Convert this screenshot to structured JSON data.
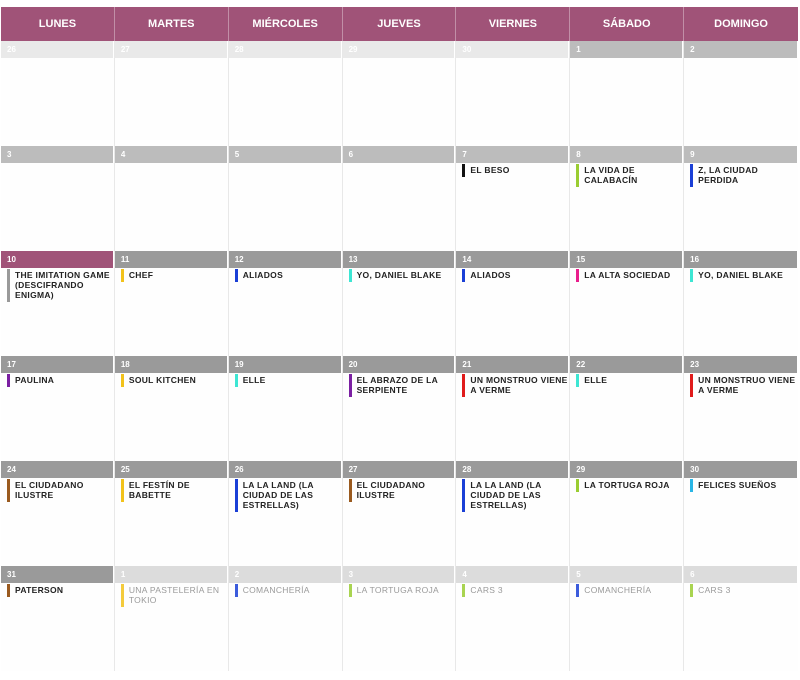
{
  "header": {
    "days": [
      "LUNES",
      "MARTES",
      "MIÉRCOLES",
      "JUEVES",
      "VIERNES",
      "SÁBADO",
      "DOMINGO"
    ]
  },
  "weeks": [
    [
      {
        "day": "26",
        "state": "outside",
        "events": []
      },
      {
        "day": "27",
        "state": "outside",
        "events": []
      },
      {
        "day": "28",
        "state": "outside",
        "events": []
      },
      {
        "day": "29",
        "state": "outside",
        "events": []
      },
      {
        "day": "30",
        "state": "outside",
        "events": []
      },
      {
        "day": "1",
        "state": "current",
        "events": []
      },
      {
        "day": "2",
        "state": "current",
        "events": []
      }
    ],
    [
      {
        "day": "3",
        "state": "current",
        "events": []
      },
      {
        "day": "4",
        "state": "current",
        "events": []
      },
      {
        "day": "5",
        "state": "current",
        "events": []
      },
      {
        "day": "6",
        "state": "current",
        "events": []
      },
      {
        "day": "7",
        "state": "current",
        "events": [
          {
            "title": "EL BESO",
            "color": "#111111"
          }
        ]
      },
      {
        "day": "8",
        "state": "current",
        "events": [
          {
            "title": "LA VIDA DE CALABACÍN",
            "color": "#9acd32"
          }
        ]
      },
      {
        "day": "9",
        "state": "current",
        "events": [
          {
            "title": "Z, LA CIUDAD PERDIDA",
            "color": "#1a3fd6"
          }
        ]
      }
    ],
    [
      {
        "day": "10",
        "state": "today",
        "events": [
          {
            "title": "THE IMITATION GAME (DESCIFRANDO ENIGMA)",
            "color": "#999999"
          }
        ]
      },
      {
        "day": "11",
        "state": "dark",
        "events": [
          {
            "title": "CHEF",
            "color": "#f2c21a"
          }
        ]
      },
      {
        "day": "12",
        "state": "dark",
        "events": [
          {
            "title": "ALIADOS",
            "color": "#1a3fd6"
          }
        ]
      },
      {
        "day": "13",
        "state": "dark",
        "events": [
          {
            "title": "YO, DANIEL BLAKE",
            "color": "#3de6d3"
          }
        ]
      },
      {
        "day": "14",
        "state": "dark",
        "events": [
          {
            "title": "ALIADOS",
            "color": "#1a3fd6"
          }
        ]
      },
      {
        "day": "15",
        "state": "dark",
        "events": [
          {
            "title": "LA ALTA SOCIEDAD",
            "color": "#e91e8c"
          }
        ]
      },
      {
        "day": "16",
        "state": "dark",
        "events": [
          {
            "title": "YO, DANIEL BLAKE",
            "color": "#3de6d3"
          }
        ]
      }
    ],
    [
      {
        "day": "17",
        "state": "dark",
        "events": [
          {
            "title": "PAULINA",
            "color": "#7b1fa2"
          }
        ]
      },
      {
        "day": "18",
        "state": "dark",
        "events": [
          {
            "title": "SOUL KITCHEN",
            "color": "#f2c21a"
          }
        ]
      },
      {
        "day": "19",
        "state": "dark",
        "events": [
          {
            "title": "ELLE",
            "color": "#3de6d3"
          }
        ]
      },
      {
        "day": "20",
        "state": "dark",
        "events": [
          {
            "title": "EL ABRAZO DE LA SERPIENTE",
            "color": "#7b1fa2"
          }
        ]
      },
      {
        "day": "21",
        "state": "dark",
        "events": [
          {
            "title": "UN MONSTRUO VIENE A VERME",
            "color": "#e01b1b"
          }
        ]
      },
      {
        "day": "22",
        "state": "dark",
        "events": [
          {
            "title": "ELLE",
            "color": "#3de6d3"
          }
        ]
      },
      {
        "day": "23",
        "state": "dark",
        "events": [
          {
            "title": "UN MONSTRUO VIENE A VERME",
            "color": "#e01b1b"
          }
        ]
      }
    ],
    [
      {
        "day": "24",
        "state": "dark",
        "events": [
          {
            "title": "EL CIUDADANO ILUSTRE",
            "color": "#9a5a1f"
          }
        ]
      },
      {
        "day": "25",
        "state": "dark",
        "events": [
          {
            "title": "EL FESTÍN DE BABETTE",
            "color": "#f2c21a"
          }
        ]
      },
      {
        "day": "26",
        "state": "dark",
        "events": [
          {
            "title": "LA LA LAND (LA CIUDAD DE LAS ESTRELLAS)",
            "color": "#1a3fd6"
          }
        ]
      },
      {
        "day": "27",
        "state": "dark",
        "events": [
          {
            "title": "EL CIUDADANO ILUSTRE",
            "color": "#9a5a1f"
          }
        ]
      },
      {
        "day": "28",
        "state": "dark",
        "events": [
          {
            "title": "LA LA LAND (LA CIUDAD DE LAS ESTRELLAS)",
            "color": "#1a3fd6"
          }
        ]
      },
      {
        "day": "29",
        "state": "dark",
        "events": [
          {
            "title": "LA TORTUGA ROJA",
            "color": "#9acd32"
          }
        ]
      },
      {
        "day": "30",
        "state": "dark",
        "events": [
          {
            "title": "FELICES SUEÑOS",
            "color": "#29b6e6"
          }
        ]
      }
    ],
    [
      {
        "day": "31",
        "state": "dark",
        "events": [
          {
            "title": "PATERSON",
            "color": "#9a5a1f"
          }
        ]
      },
      {
        "day": "1",
        "state": "outside-light",
        "events": [
          {
            "title": "UNA PASTELERÍA EN TOKIO",
            "color": "#f2c21a",
            "faded": true
          }
        ]
      },
      {
        "day": "2",
        "state": "outside-light",
        "events": [
          {
            "title": "COMANCHERÍA",
            "color": "#1a3fd6",
            "faded": true
          }
        ]
      },
      {
        "day": "3",
        "state": "outside-light",
        "events": [
          {
            "title": "LA TORTUGA ROJA",
            "color": "#9acd32",
            "faded": true
          }
        ]
      },
      {
        "day": "4",
        "state": "outside-light",
        "events": [
          {
            "title": "CARS 3",
            "color": "#9acd32",
            "faded": true
          }
        ]
      },
      {
        "day": "5",
        "state": "outside-light",
        "events": [
          {
            "title": "COMANCHERÍA",
            "color": "#1a3fd6",
            "faded": true
          }
        ]
      },
      {
        "day": "6",
        "state": "outside-light",
        "events": [
          {
            "title": "CARS 3",
            "color": "#9acd32",
            "faded": true
          }
        ]
      }
    ]
  ]
}
